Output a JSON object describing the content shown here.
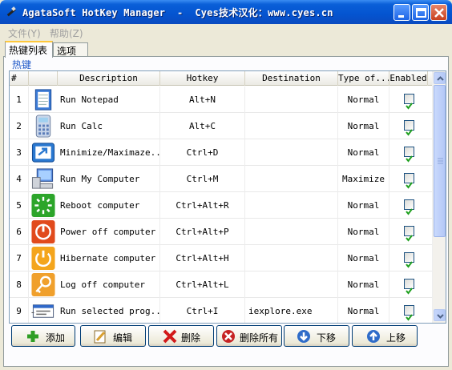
{
  "window": {
    "title": "AgataSoft HotKey Manager  -  Cyes技术汉化：www.cyes.cn"
  },
  "menu": [
    {
      "label": "文件(Y)"
    },
    {
      "label": "帮助(Z)"
    }
  ],
  "tabs": [
    {
      "label": "热键列表",
      "active": true
    },
    {
      "label": "选项",
      "active": false
    }
  ],
  "group": {
    "label": "热键"
  },
  "grid": {
    "columns": [
      "#",
      "",
      "Description",
      "Hotkey",
      "Destination",
      "Type of...",
      "Enabled"
    ],
    "rows": [
      {
        "num": "1",
        "icon": "notepad-icon",
        "description": "Run Notepad",
        "hotkey": "Alt+N",
        "destination": "",
        "type": "Normal",
        "enabled": true
      },
      {
        "num": "2",
        "icon": "calculator-icon",
        "description": "Run Calc",
        "hotkey": "Alt+C",
        "destination": "",
        "type": "Normal",
        "enabled": true
      },
      {
        "num": "3",
        "icon": "minimize-maximize-icon",
        "description": "Minimize/Maximaze...",
        "hotkey": "Ctrl+D",
        "destination": "",
        "type": "Normal",
        "enabled": true
      },
      {
        "num": "4",
        "icon": "my-computer-icon",
        "description": "Run My Computer",
        "hotkey": "Ctrl+M",
        "destination": "",
        "type": "Maximize",
        "enabled": true
      },
      {
        "num": "5",
        "icon": "reboot-icon",
        "description": "Reboot computer",
        "hotkey": "Ctrl+Alt+R",
        "destination": "",
        "type": "Normal",
        "enabled": true
      },
      {
        "num": "6",
        "icon": "power-off-icon",
        "description": "Power off computer",
        "hotkey": "Ctrl+Alt+P",
        "destination": "",
        "type": "Normal",
        "enabled": true
      },
      {
        "num": "7",
        "icon": "hibernate-icon",
        "description": "Hibernate computer",
        "hotkey": "Ctrl+Alt+H",
        "destination": "",
        "type": "Normal",
        "enabled": true
      },
      {
        "num": "8",
        "icon": "log-off-key-icon",
        "description": "Log off computer",
        "hotkey": "Ctrl+Alt+L",
        "destination": "",
        "type": "Normal",
        "enabled": true
      },
      {
        "num": "9",
        "icon": "run-program-icon",
        "description": "Run selected prog...",
        "hotkey": "Ctrl+I",
        "destination": "iexplore.exe",
        "type": "Normal",
        "enabled": true
      }
    ]
  },
  "buttons": [
    {
      "label": "添加",
      "icon": "plus-icon"
    },
    {
      "label": "编辑",
      "icon": "edit-icon"
    },
    {
      "label": "删除",
      "icon": "delete-x-icon"
    },
    {
      "label": "删除所有",
      "icon": "delete-all-icon"
    },
    {
      "label": "下移",
      "icon": "arrow-down-icon"
    },
    {
      "label": "上移",
      "icon": "arrow-up-icon"
    }
  ],
  "colors": {
    "titlebar": "#0454d0",
    "check": "#21a121",
    "group_label": "#1e57c8"
  }
}
